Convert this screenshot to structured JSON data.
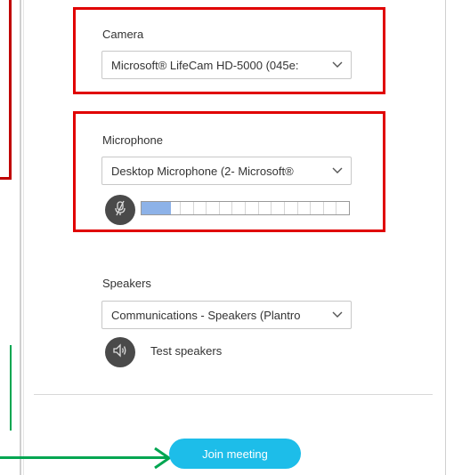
{
  "camera": {
    "label": "Camera",
    "selected": "Microsoft® LifeCam HD-5000 (045e:"
  },
  "microphone": {
    "label": "Microphone",
    "selected": "Desktop Microphone (2- Microsoft®",
    "muted_icon": "mic-muted-icon",
    "level": 0.14
  },
  "speakers": {
    "label": "Speakers",
    "selected": "Communications - Speakers (Plantro",
    "test_label": "Test speakers",
    "icon": "speaker-icon"
  },
  "actions": {
    "join_label": "Join meeting"
  },
  "colors": {
    "highlight_red": "#e00000",
    "arrow_green": "#00a651",
    "join_button": "#1dbde9",
    "meter_fill": "#8db2e8"
  }
}
